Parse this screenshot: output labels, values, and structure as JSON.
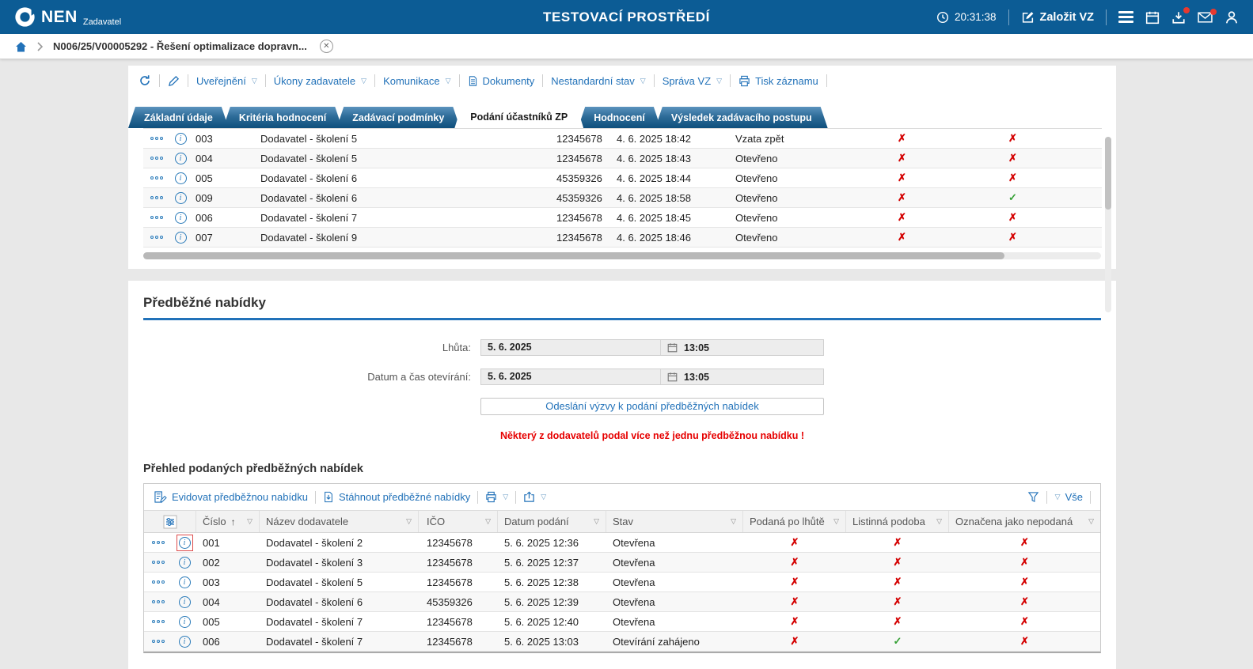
{
  "header": {
    "brand": "NEN",
    "brand_sub": "Zadavatel",
    "environment": "TESTOVACÍ PROSTŘEDÍ",
    "clock": "20:31:38",
    "create_button": "Založit VZ"
  },
  "breadcrumb": {
    "record": "N006/25/V00005292 - Řešení optimalizace dopravn..."
  },
  "toolbar": {
    "items": [
      "Uveřejnění",
      "Úkony zadavatele",
      "Komunikace",
      "Dokumenty",
      "Nestandardní stav",
      "Správa VZ",
      "Tisk záznamu"
    ]
  },
  "tabs": [
    "Základní údaje",
    "Kritéria hodnocení",
    "Zadávací podmínky",
    "Podání účastníků ZP",
    "Hodnocení",
    "Výsledek zadávacího postupu"
  ],
  "active_tab": "Podání účastníků ZP",
  "participants_table": {
    "rows": [
      {
        "num": "003",
        "supplier": "Dodavatel - školení 5",
        "ico": "12345678",
        "date": "4. 6. 2025 18:42",
        "status": "Vzata zpět",
        "flag1": "x",
        "flag2": "x"
      },
      {
        "num": "004",
        "supplier": "Dodavatel - školení 5",
        "ico": "12345678",
        "date": "4. 6. 2025 18:43",
        "status": "Otevřeno",
        "flag1": "x",
        "flag2": "x"
      },
      {
        "num": "005",
        "supplier": "Dodavatel - školení 6",
        "ico": "45359326",
        "date": "4. 6. 2025 18:44",
        "status": "Otevřeno",
        "flag1": "x",
        "flag2": "x"
      },
      {
        "num": "009",
        "supplier": "Dodavatel - školení 6",
        "ico": "45359326",
        "date": "4. 6. 2025 18:58",
        "status": "Otevřeno",
        "flag1": "x",
        "flag2": "check"
      },
      {
        "num": "006",
        "supplier": "Dodavatel - školení 7",
        "ico": "12345678",
        "date": "4. 6. 2025 18:45",
        "status": "Otevřeno",
        "flag1": "x",
        "flag2": "x"
      },
      {
        "num": "007",
        "supplier": "Dodavatel - školení 9",
        "ico": "12345678",
        "date": "4. 6. 2025 18:46",
        "status": "Otevřeno",
        "flag1": "x",
        "flag2": "x"
      }
    ]
  },
  "preliminary_offers": {
    "section_title": "Předběžné nabídky",
    "deadline_label": "Lhůta:",
    "deadline_date": "5. 6. 2025",
    "deadline_time": "13:05",
    "opening_label": "Datum a čas otevírání:",
    "opening_date": "5. 6. 2025",
    "opening_time": "13:05",
    "send_button": "Odeslání výzvy k podání předběžných nabídek",
    "warning": "Některý z dodavatelů podal více než jednu předběžnou nabídku !"
  },
  "offers_grid": {
    "title": "Přehled podaných předběžných nabídek",
    "toolbar": {
      "record_offer": "Evidovat předběžnou nabídku",
      "download_offers": "Stáhnout předběžné nabídky",
      "all_filter": "Vše"
    },
    "columns": [
      "Číslo",
      "Název dodavatele",
      "IČO",
      "Datum podání",
      "Stav",
      "Podaná po lhůtě",
      "Listinná podoba",
      "Označena jako nepodaná"
    ],
    "rows": [
      {
        "num": "001",
        "supplier": "Dodavatel - školení 2",
        "ico": "12345678",
        "date": "5. 6. 2025 12:36",
        "status": "Otevřena",
        "late": "x",
        "paper": "x",
        "not_submitted": "x",
        "highlight_info": true
      },
      {
        "num": "002",
        "supplier": "Dodavatel - školení 3",
        "ico": "12345678",
        "date": "5. 6. 2025 12:37",
        "status": "Otevřena",
        "late": "x",
        "paper": "x",
        "not_submitted": "x",
        "highlight_info": false
      },
      {
        "num": "003",
        "supplier": "Dodavatel - školení 5",
        "ico": "12345678",
        "date": "5. 6. 2025 12:38",
        "status": "Otevřena",
        "late": "x",
        "paper": "x",
        "not_submitted": "x",
        "highlight_info": false
      },
      {
        "num": "004",
        "supplier": "Dodavatel - školení 6",
        "ico": "45359326",
        "date": "5. 6. 2025 12:39",
        "status": "Otevřena",
        "late": "x",
        "paper": "x",
        "not_submitted": "x",
        "highlight_info": false
      },
      {
        "num": "005",
        "supplier": "Dodavatel - školení 7",
        "ico": "12345678",
        "date": "5. 6. 2025 12:40",
        "status": "Otevřena",
        "late": "x",
        "paper": "x",
        "not_submitted": "x",
        "highlight_info": false
      },
      {
        "num": "006",
        "supplier": "Dodavatel - školení 7",
        "ico": "12345678",
        "date": "5. 6. 2025 13:03",
        "status": "Otevírání zahájeno",
        "late": "x",
        "paper": "check",
        "not_submitted": "x",
        "highlight_info": false
      }
    ]
  },
  "icons": {
    "mark_cross": "✗",
    "mark_check": "✓",
    "filter_dropdown": "▽",
    "sort_ascending": "↑"
  },
  "colors": {
    "header_blue": "#0c5c95",
    "link_blue": "#2272b9",
    "cross_red": "#d40000",
    "check_green": "#35a035",
    "warning_red": "#e60000"
  }
}
